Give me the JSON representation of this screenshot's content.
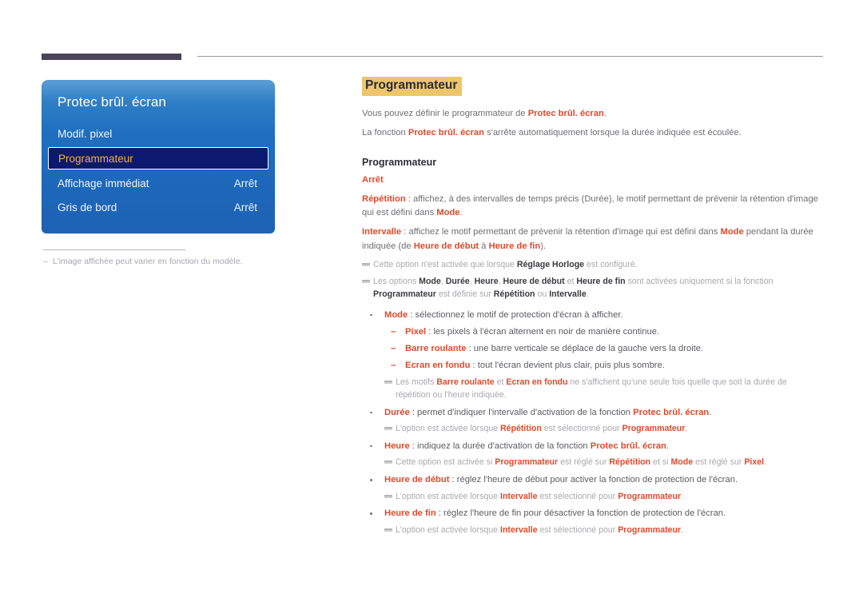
{
  "colors": {
    "accent_red": "#e0492b",
    "title_highlight": "#edc66b",
    "osd_blue": "#1f6fc0",
    "osd_selected_bg": "#0b1a6e",
    "osd_selected_text": "#f5b429",
    "top_tab": "#4b4458",
    "note_grey": "#a9a9ae"
  },
  "osd": {
    "title": "Protec brûl. écran",
    "rows": [
      {
        "label": "Modif. pixel",
        "value": "",
        "selected": false
      },
      {
        "label": "Programmateur",
        "value": "",
        "selected": true
      },
      {
        "label": "Affichage immédiat",
        "value": "Arrêt",
        "selected": false
      },
      {
        "label": "Gris de bord",
        "value": "Arrêt",
        "selected": false
      }
    ],
    "footnote_dash": "–",
    "footnote": "L'image affichée peut varier en fonction du modèle."
  },
  "doc": {
    "title": "Programmateur",
    "intro_1": {
      "before": "Vous pouvez définir le programmateur de ",
      "bold": "Protec brûl. écran",
      "after": "."
    },
    "intro_2": {
      "before": "La fonction ",
      "bold": "Protec brûl. écran",
      "after": " s'arrête automatiquement lorsque la durée indiquée est écoulée."
    },
    "section_heading": "Programmateur",
    "sub_heading": "Arrêt",
    "repetition": {
      "term": "Répétition",
      "text_1": " : affichez, à des intervalles de temps précis (Durée), le motif permettant de prévenir la rétention d'image qui est défini dans ",
      "term_2": "Mode",
      "text_2": "."
    },
    "intervalle": {
      "term": "Intervalle",
      "text_1": " : affichez le motif permettant de prévenir la rétention d'image qui est défini dans ",
      "term_2": "Mode",
      "text_2": " pendant la durée indiquée (de ",
      "term_3": "Heure de début",
      "text_3": " à ",
      "term_4": "Heure de fin",
      "text_4": ")."
    },
    "note_clock": {
      "text_1": "Cette option n'est activée que lorsque ",
      "bold_1": "Réglage Horloge",
      "text_2": " est configuré."
    },
    "note_options": {
      "text_1": "Les options ",
      "b1": "Mode",
      "s1": ", ",
      "b2": "Durée",
      "s2": ", ",
      "b3": "Heure",
      "s3": ", ",
      "b4": "Heure de début",
      "s4": " et ",
      "b5": "Heure de fin",
      "text_2": " sont activées uniquement si la fonction ",
      "b6": "Programmateur",
      "text_3": " est définie sur ",
      "b7": "Répétition",
      "text_4": " ou ",
      "b8": "Intervalle",
      "text_5": "."
    },
    "bullets": {
      "mode": {
        "term": "Mode",
        "text": " : sélectionnez le motif de protection d'écran à afficher.",
        "sub": [
          {
            "term": "Pixel",
            "text": " : les pixels à l'écran alternent en noir de manière continue."
          },
          {
            "term": "Barre roulante",
            "text": " : une barre verticale se déplace de la gauche vers la droite."
          },
          {
            "term": "Ecran en fondu",
            "text": " : tout l'écran devient plus clair, puis plus sombre."
          }
        ],
        "note": {
          "text_1": "Les motifs ",
          "b1": "Barre roulante",
          "text_2": " et ",
          "b2": "Ecran en fondu",
          "text_3": " ne s'affichent qu'une seule fois quelle que soit la durée de répétition ou l'heure indiquée."
        }
      },
      "duree": {
        "term": "Durée",
        "text_1": " : permet d'indiquer l'intervalle d'activation de la fonction ",
        "term_2": "Protec brûl. écran",
        "text_2": ".",
        "note": {
          "text_1": "L'option est activée lorsque ",
          "b1": "Répétition",
          "text_2": " est sélectionné pour ",
          "b2": "Programmateur",
          "text_3": "."
        }
      },
      "heure": {
        "term": "Heure",
        "text_1": " : indiquez la durée d'activation de la fonction ",
        "term_2": "Protec brûl. écran",
        "text_2": ".",
        "note": {
          "text_1": "Cette option est activée si ",
          "b1": "Programmateur",
          "text_2": " est réglé sur ",
          "b2": "Répétition",
          "text_3": " et si ",
          "b3": "Mode",
          "text_4": " est réglé sur ",
          "b4": "Pixel",
          "text_5": "."
        }
      },
      "heure_debut": {
        "term": "Heure de début",
        "text_1": " : réglez l'heure de début pour activer la fonction de protection de l'écran.",
        "note": {
          "text_1": "L'option est activée lorsque ",
          "b1": "Intervalle",
          "text_2": " est sélectionné pour ",
          "b2": "Programmateur",
          "text_3": "."
        }
      },
      "heure_fin": {
        "term": "Heure de fin",
        "text_1": " : réglez l'heure de fin pour désactiver la fonction de protection de l'écran.",
        "note": {
          "text_1": "L'option est activée lorsque ",
          "b1": "Intervalle",
          "text_2": " est sélectionné pour ",
          "b2": "Programmateur",
          "text_3": "."
        }
      }
    }
  }
}
